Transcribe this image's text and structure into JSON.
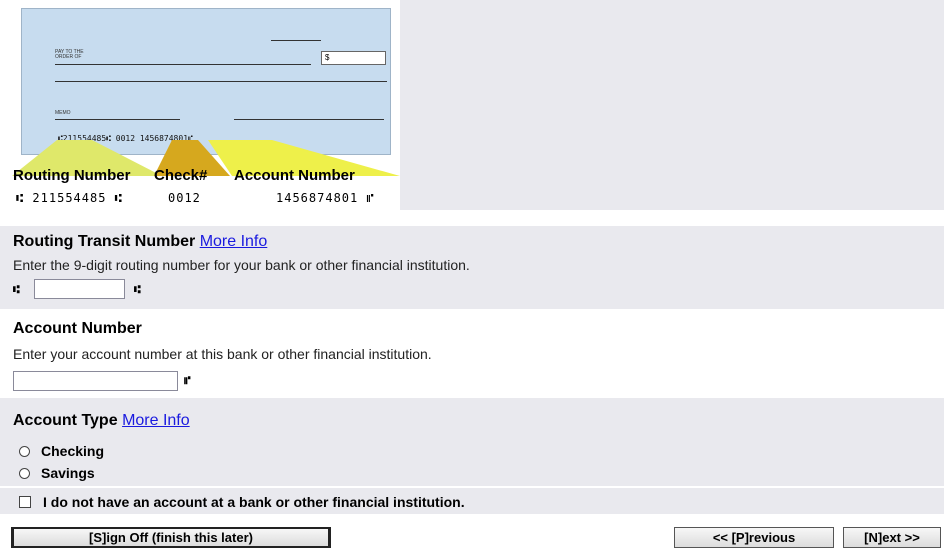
{
  "check": {
    "pay_to_label": "PAY TO THE ORDER OF",
    "dollar_sign": "$",
    "memo_label": "MEMO",
    "micr_line": "⑆211554485⑆  0012  1456874801⑈",
    "labels": {
      "routing": "Routing Number",
      "check_no": "Check#",
      "account": "Account Number"
    },
    "micr_routing": "⑆ 211554485 ⑆",
    "micr_check": "0012",
    "micr_account": "1456874801 ⑈"
  },
  "routing_section": {
    "title": "Routing Transit Number",
    "more_info": "More Info",
    "description": "Enter the 9-digit routing number for your bank or other financial institution.",
    "value": "",
    "symbol": "⑆"
  },
  "account_section": {
    "title": "Account Number",
    "description": "Enter your account number at this bank or other financial institution.",
    "value": "",
    "symbol": "⑈"
  },
  "account_type_section": {
    "title": "Account Type",
    "more_info": "More Info",
    "options": [
      "Checking",
      "Savings"
    ],
    "no_account_label": "I do not have an account at a bank or other financial institution."
  },
  "buttons": {
    "sign_off": "[S]ign Off (finish this later)",
    "previous": "<< [P]revious",
    "next": "[N]ext >>"
  },
  "colors": {
    "section_bg": "#e9e9ee",
    "check_bg": "#c7dcef",
    "link": "#1a1adf",
    "beam_routing": "#dfe86a",
    "beam_check": "#d6a81e",
    "beam_account": "#eef04a"
  }
}
